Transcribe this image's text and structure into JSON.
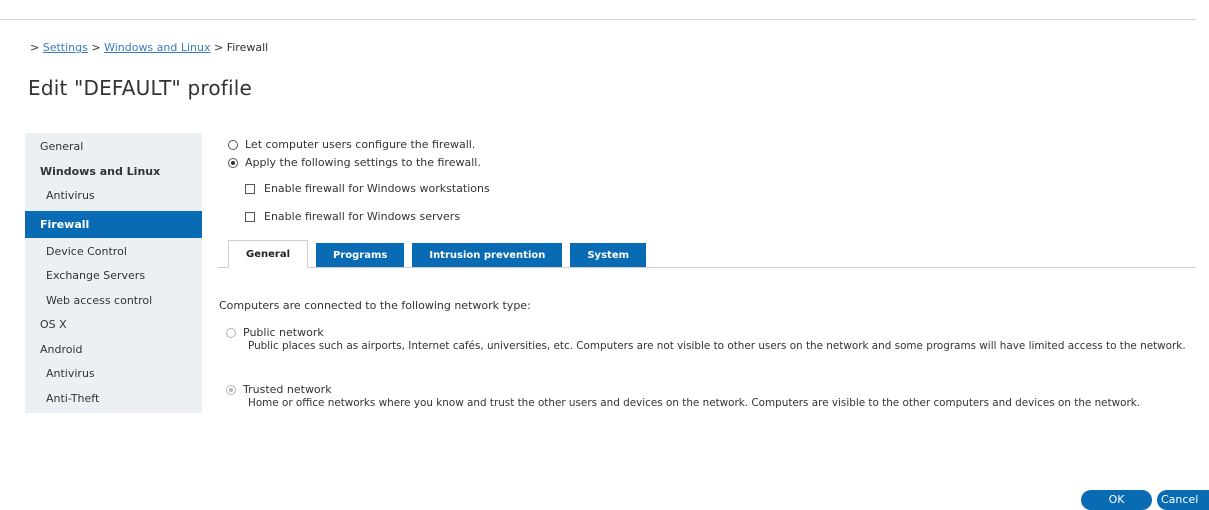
{
  "breadcrumb": {
    "prefix": "> ",
    "link1": "Settings",
    "sep1": " > ",
    "link2": "Windows and Linux",
    "sep2": " > ",
    "current": "Firewall"
  },
  "page_title": "Edit \"DEFAULT\" profile",
  "sidebar": {
    "items": [
      {
        "label": "General"
      },
      {
        "label": "Windows and Linux"
      },
      {
        "label": "Antivirus"
      },
      {
        "label": "Firewall"
      },
      {
        "label": "Device Control"
      },
      {
        "label": "Exchange Servers"
      },
      {
        "label": "Web access control"
      },
      {
        "label": "OS X"
      },
      {
        "label": "Android"
      },
      {
        "label": "Antivirus"
      },
      {
        "label": "Anti-Theft"
      }
    ]
  },
  "firewall_mode": {
    "option_users": "Let computer users configure the firewall.",
    "option_apply": "Apply the following settings to the firewall.",
    "selected": "option_apply"
  },
  "checkboxes": {
    "workstations": {
      "label": "Enable firewall for Windows workstations",
      "checked": false
    },
    "servers": {
      "label": "Enable firewall for Windows servers",
      "checked": false
    }
  },
  "tabs": [
    {
      "label": "General",
      "active": true
    },
    {
      "label": "Programs",
      "active": false
    },
    {
      "label": "Intrusion prevention",
      "active": false
    },
    {
      "label": "System",
      "active": false
    }
  ],
  "network": {
    "intro": "Computers are connected to the following network type:",
    "public": {
      "label": "Public network",
      "desc": "Public places such as airports, Internet cafés, universities, etc. Computers are not visible to other users on the network and some programs will have limited access to the network."
    },
    "trusted": {
      "label": "Trusted network",
      "desc": "Home or office networks where you know and trust the other users and devices on the network. Computers are visible to the other computers and devices on the network."
    },
    "selected": "trusted"
  },
  "buttons": {
    "ok": "OK",
    "cancel": "Cancel"
  },
  "colors": {
    "accent": "#0a6bb5",
    "sidebar_bg": "#ecf0f5",
    "link": "#3a7bbf"
  }
}
